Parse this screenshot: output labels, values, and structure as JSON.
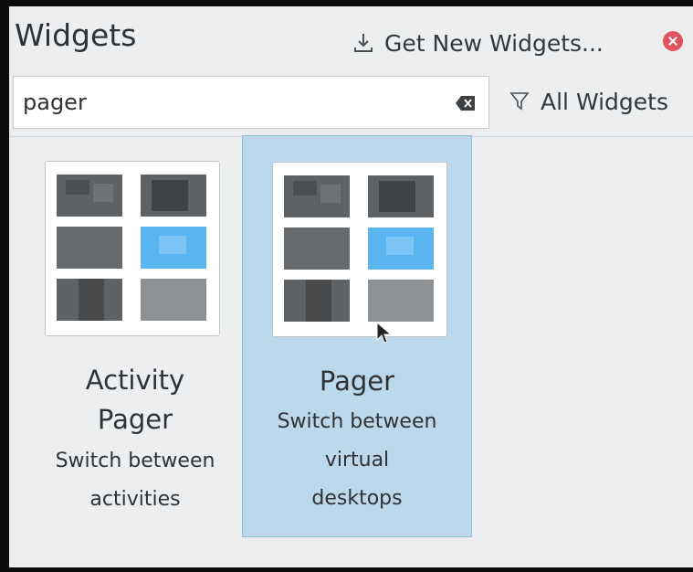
{
  "header": {
    "title": "Widgets",
    "get_new_label": "Get New Widgets...",
    "get_new_icon": "download-icon",
    "close_icon": "close-icon"
  },
  "search": {
    "value": "pager",
    "clear_icon": "clear-text-icon",
    "filter_icon": "filter-icon",
    "filter_label": "All Widgets"
  },
  "widgets": [
    {
      "title_line1": "Activity",
      "title_line2": "Pager",
      "desc_line1": "Switch between",
      "desc_line2": "activities",
      "selected": false
    },
    {
      "title_line1": "Pager",
      "desc_line1": "Switch between",
      "desc_line2": "virtual",
      "desc_line3": "desktops",
      "selected": true
    }
  ],
  "colors": {
    "panel_bg": "#eceef0",
    "selection_bg": "#bcd8ec",
    "selection_border": "#8ebcdc",
    "active_desktop": "#59b4f0",
    "close_button": "#e0535f"
  }
}
